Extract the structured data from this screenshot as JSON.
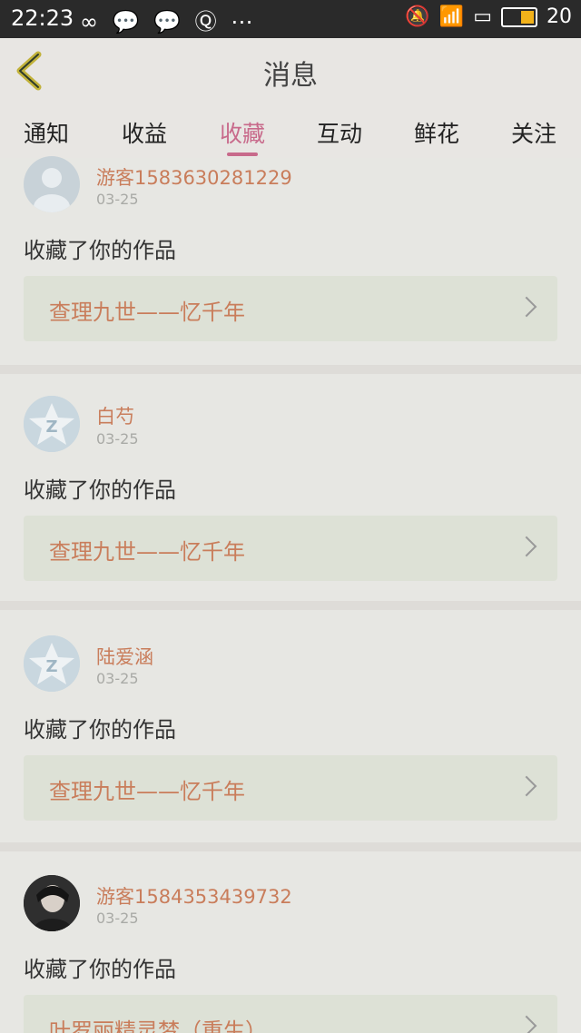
{
  "status": {
    "time": "22:23",
    "battery": "20"
  },
  "header": {
    "title": "消息"
  },
  "tabs": [
    "通知",
    "收益",
    "收藏",
    "互动",
    "鲜花",
    "关注"
  ],
  "messages": [
    {
      "user": "游客1583630281229",
      "date": "03-25",
      "action": "收藏了你的作品",
      "work": "查理九世——忆千年",
      "avatar": "default-avatar"
    },
    {
      "user": "白芍",
      "date": "03-25",
      "action": "收藏了你的作品",
      "work": "查理九世——忆千年",
      "avatar": "qzone-avatar"
    },
    {
      "user": "陆爱涵",
      "date": "03-25",
      "action": "收藏了你的作品",
      "work": "查理九世——忆千年",
      "avatar": "qzone-avatar"
    },
    {
      "user": "游客1584353439732",
      "date": "03-25",
      "action": "收藏了你的作品",
      "work": "叶罗丽精灵梦（重生）",
      "avatar": "photo-avatar"
    }
  ],
  "colors": {
    "accent": "#c86a8b",
    "username": "#c97d5b"
  }
}
